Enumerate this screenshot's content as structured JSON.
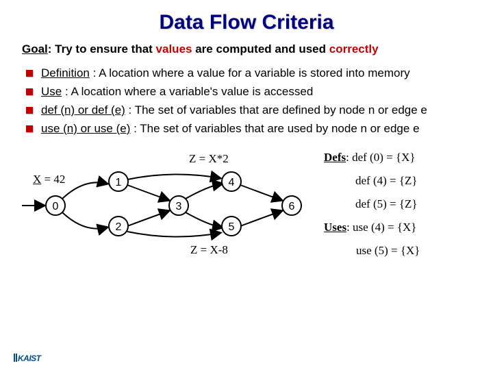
{
  "title": "Data Flow Criteria",
  "goal": {
    "label": "Goal",
    "text": ": Try to ensure that ",
    "em1": "values",
    "mid": " are computed and used ",
    "em2": "correctly"
  },
  "bullets": [
    {
      "term": "Definition",
      "rest": " : A location where a value for a variable is stored into memory"
    },
    {
      "term": "Use",
      "rest": " : A location where a variable's value is accessed"
    },
    {
      "term": "def (n) or def (e)",
      "rest": " : The set of variables that are defined by node n or edge e"
    },
    {
      "term": "use (n) or use (e)",
      "rest": " : The set of variables that are used by node n or edge e"
    }
  ],
  "graph": {
    "nodes": {
      "n0": "0",
      "n1": "1",
      "n2": "2",
      "n3": "3",
      "n4": "4",
      "n5": "5",
      "n6": "6"
    },
    "annotations": {
      "x42_label": "X",
      "x42_eq": " = 42",
      "zx2": "Z = X*2",
      "zx8": "Z = X-8"
    },
    "right": {
      "defs_label": "Defs",
      "def0": ": def (0) = {X}",
      "def4": "def (4) = {Z}",
      "def5": "def (5) = {Z}",
      "uses_label": "Uses",
      "use4": ": use (4) = {X}",
      "use5": "use (5) = {X}"
    }
  },
  "logo": "KAIST"
}
